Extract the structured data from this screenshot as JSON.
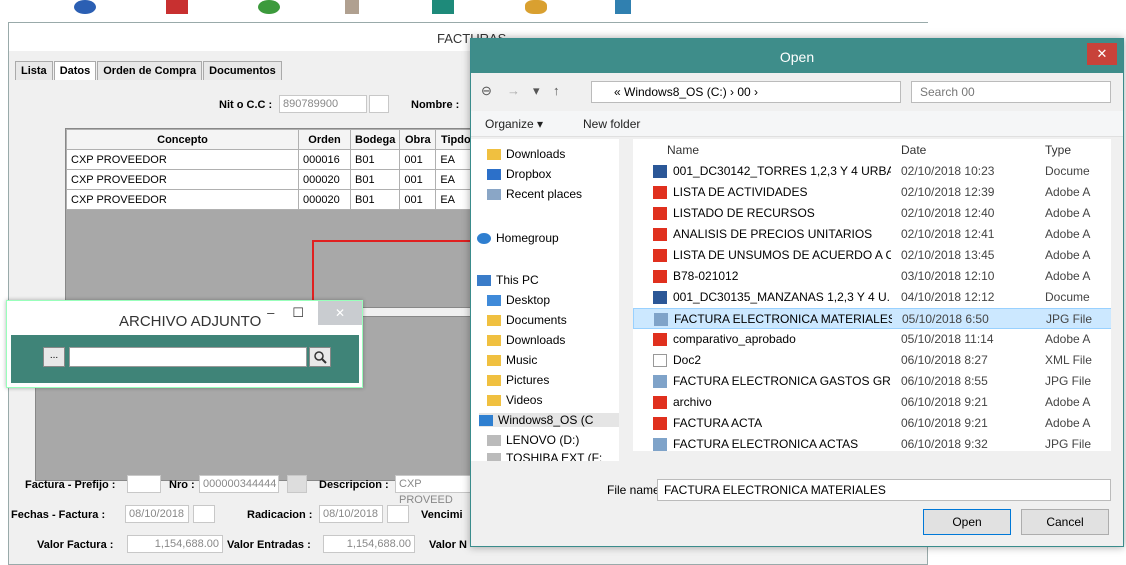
{
  "facturas": {
    "title": "FACTURAS",
    "tabs": [
      "Lista",
      "Datos",
      "Orden de Compra",
      "Documentos"
    ],
    "nit_label": "Nit o C.C :",
    "nit_value": "890789900",
    "nombre_label": "Nombre :",
    "grid_headers": [
      "Concepto",
      "Orden",
      "Bodega",
      "Obra",
      "Tipdo"
    ],
    "grid_rows": [
      [
        "CXP PROVEEDOR",
        "000016",
        "B01",
        "001",
        "EA"
      ],
      [
        "CXP PROVEEDOR",
        "000020",
        "B01",
        "001",
        "EA"
      ],
      [
        "CXP PROVEEDOR",
        "000020",
        "B01",
        "001",
        "EA"
      ]
    ],
    "factura_prefijo_label": "Factura - Prefijo :",
    "nro_label": "Nro :",
    "nro_value": "000000344444",
    "descripcion_label": "Descripcion :",
    "descripcion_value": "CXP PROVEED",
    "fechas_label": "Fechas - Factura :",
    "fecha_factura": "08/10/2018",
    "radicacion_label": "Radicacion :",
    "fecha_radicacion": "08/10/2018",
    "vencimiento_label": "Vencimi",
    "valor_factura_label": "Valor Factura :",
    "valor_factura": "1,154,688.00",
    "valor_entradas_label": "Valor Entradas :",
    "valor_entradas": "1,154,688.00",
    "valor_n_label": "Valor N"
  },
  "adjunto": {
    "title": "ARCHIVO ADJUNTO",
    "browse_label": "...",
    "minimize": "–",
    "maximize": "☐",
    "close": "✕"
  },
  "open_dialog": {
    "title": "Open",
    "close": "✕",
    "address": "« Windows8_OS (C:) › 00 ›",
    "search_placeholder": "Search 00",
    "organize": "Organize ▾",
    "new_folder": "New folder",
    "col_name": "Name",
    "col_date": "Date",
    "col_type": "Type",
    "nav_items": [
      "Downloads",
      "Dropbox",
      "Recent places",
      "Homegroup",
      "This PC",
      "Desktop",
      "Documents",
      "Downloads",
      "Music",
      "Pictures",
      "Videos",
      "Windows8_OS (C",
      "LENOVO (D:)",
      "TOSHIBA EXT (F:"
    ],
    "files": [
      {
        "name": "001_DC30142_TORRES 1,2,3 Y 4 URBA...",
        "date": "02/10/2018 10:23",
        "type": "Docume",
        "icon": "doc"
      },
      {
        "name": "LISTA DE ACTIVIDADES",
        "date": "02/10/2018 12:39",
        "type": "Adobe A",
        "icon": "pdf"
      },
      {
        "name": "LISTADO DE RECURSOS",
        "date": "02/10/2018 12:40",
        "type": "Adobe A",
        "icon": "pdf"
      },
      {
        "name": "ANALISIS DE PRECIOS UNITARIOS",
        "date": "02/10/2018 12:41",
        "type": "Adobe A",
        "icon": "pdf"
      },
      {
        "name": "LISTA DE UNSUMOS DE ACUERDO A C...",
        "date": "02/10/2018 13:45",
        "type": "Adobe A",
        "icon": "pdf"
      },
      {
        "name": "B78-021012",
        "date": "03/10/2018 12:10",
        "type": "Adobe A",
        "icon": "pdf"
      },
      {
        "name": "001_DC30135_MANZANAS 1,2,3 Y 4 U...",
        "date": "04/10/2018 12:12",
        "type": "Docume",
        "icon": "doc"
      },
      {
        "name": "FACTURA ELECTRONICA MATERIALES",
        "date": "05/10/2018 6:50",
        "type": "JPG File",
        "icon": "jpg",
        "selected": true
      },
      {
        "name": "comparativo_aprobado",
        "date": "05/10/2018 11:14",
        "type": "Adobe A",
        "icon": "pdf"
      },
      {
        "name": "Doc2",
        "date": "06/10/2018 8:27",
        "type": "XML File",
        "icon": "xml"
      },
      {
        "name": "FACTURA ELECTRONICA GASTOS GRL...",
        "date": "06/10/2018 8:55",
        "type": "JPG File",
        "icon": "jpg"
      },
      {
        "name": "archivo",
        "date": "06/10/2018 9:21",
        "type": "Adobe A",
        "icon": "pdf"
      },
      {
        "name": "FACTURA ACTA",
        "date": "06/10/2018 9:21",
        "type": "Adobe A",
        "icon": "pdf"
      },
      {
        "name": "FACTURA ELECTRONICA ACTAS",
        "date": "06/10/2018 9:32",
        "type": "JPG File",
        "icon": "jpg"
      }
    ],
    "file_name_label": "File name:",
    "file_name_value": "FACTURA ELECTRONICA MATERIALES",
    "open_btn": "Open",
    "cancel_btn": "Cancel"
  }
}
